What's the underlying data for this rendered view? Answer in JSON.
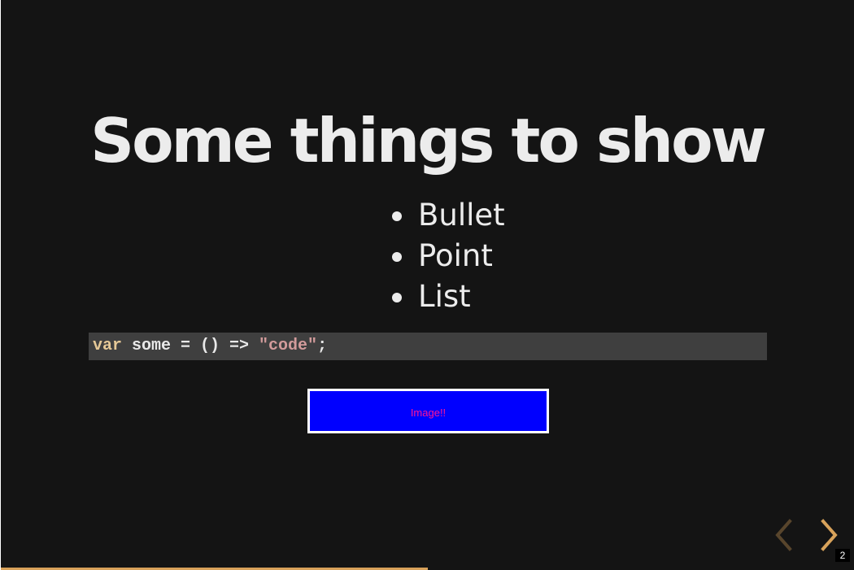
{
  "slide": {
    "title": "Some things to show",
    "bullets": [
      "Bullet",
      "Point",
      "List"
    ],
    "code": {
      "keyword": "var",
      "middle": " some = () => ",
      "string": "\"code\"",
      "end": ";"
    },
    "image_placeholder": "Image!!",
    "slide_number": "2"
  },
  "navigation": {
    "prev_icon": "chevron-left-icon",
    "next_icon": "chevron-right-icon",
    "progress_fraction": 0.5
  },
  "colors": {
    "background": "#141414",
    "text": "#ececec",
    "accent": "#d8a25a",
    "code_background": "#3f3f3f",
    "image_fill": "#0000ff",
    "image_text": "#ff1493"
  }
}
